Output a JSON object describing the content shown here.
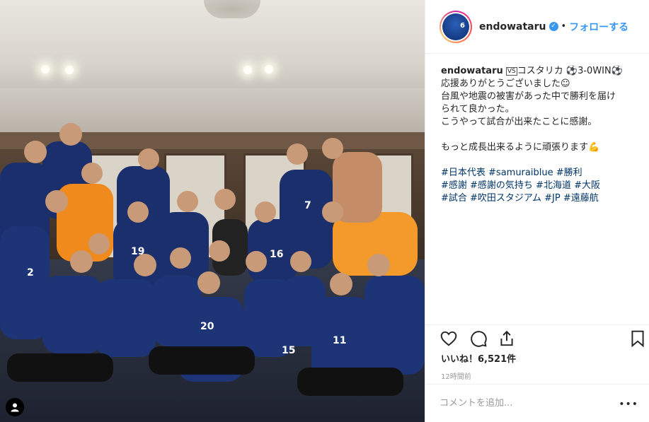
{
  "post": {
    "username": "endowataru",
    "avatar_number": "6",
    "follow_label": "フォローする",
    "separator": "•"
  },
  "caption": {
    "username": "endowataru",
    "line1_vs": "VS",
    "line1_text": "コスタリカ ⚽3-0WIN⚽",
    "line2": "応援ありがとうございました☺",
    "line3": "台風や地震の被害があった中で勝利を届け",
    "line4": "られて良かった。",
    "line5": "こうやって試合が出来たことに感謝。",
    "line6": "もっと成長出来るように頑張ります💪",
    "hashtags_line1": "#日本代表 #samuraiblue #勝利",
    "hashtags_line2": "#感謝 #感謝の気持ち #北海道 #大阪",
    "hashtags_line3": "#試合 #吹田スタジアム #JP #遠藤航"
  },
  "engagement": {
    "likes_text": "いいね！6,521件",
    "time_ago": "12時間前"
  },
  "comment": {
    "placeholder": "コメントを追加...",
    "more_label": "•••"
  },
  "colors": {
    "accent": "#3897f0",
    "hashtag": "#003569",
    "jersey_blue": "#1a2f6b",
    "keeper_orange": "#f08a1c"
  },
  "icons": [
    "heart-icon",
    "comment-icon",
    "share-icon",
    "bookmark-icon",
    "user-tag-icon",
    "verified-icon"
  ]
}
